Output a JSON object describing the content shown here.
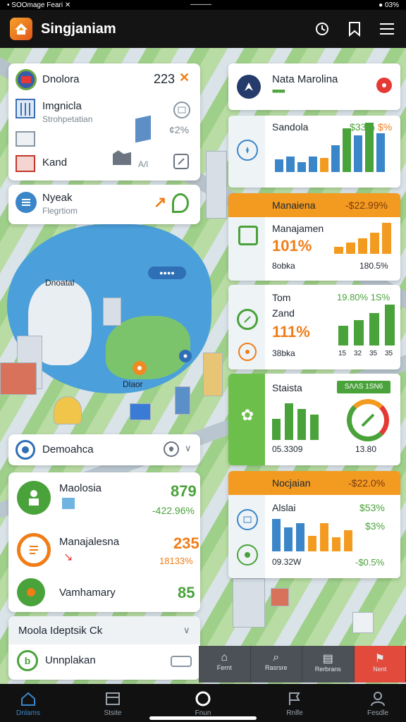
{
  "status": {
    "left": "• SOOmage Feari ✕",
    "mid": "―――",
    "right": "● 03%"
  },
  "header": {
    "title": "Singjaniam"
  },
  "left_panels": {
    "top": {
      "row1": {
        "label": "Dnolora",
        "value": "223",
        "close": "✕"
      },
      "row2": {
        "label": "Imgnicla",
        "sub": "Strohpetatian",
        "value": "¢2%"
      },
      "row3": {
        "label": "Kand",
        "tag": "A/l"
      }
    },
    "second": {
      "label": "Nyeak",
      "sub": "Flegrtiom"
    },
    "map_labels": {
      "island": "Dnoatal",
      "pill": "●●●●",
      "city": "Dlaor"
    },
    "demo": {
      "label": "Demoahca"
    },
    "stats": {
      "r1": {
        "label": "Maolosia",
        "value": "879",
        "sub": "-422.96%"
      },
      "r2": {
        "label": "Manajalesna",
        "value": "235",
        "sub": "18133%"
      },
      "r3": {
        "label": "Vamhamary",
        "value": "85"
      }
    },
    "dropdown": {
      "label": "Moola Ideptsik Ck"
    },
    "last": {
      "label": "Unnplakan"
    }
  },
  "right_panels": {
    "c1": {
      "label": "Nata Marolina",
      "tag": "■■■■"
    },
    "c2": {
      "label": "Sandola",
      "value1": "$33%",
      "value2": "$%",
      "bars": [
        18,
        22,
        14,
        22,
        20,
        38,
        62,
        52,
        70,
        55
      ]
    },
    "c3": {
      "header": "Manaiena",
      "header_value": "-$22.99%",
      "label": "Manajamen",
      "value": "101%",
      "sub": "8obka",
      "pct": "180.5%",
      "bars": [
        10,
        16,
        22,
        30,
        44
      ]
    },
    "c4": {
      "label": "Tom",
      "label2": "Zand",
      "value": "111%",
      "sub": "38bka",
      "pct": "19.80% 1S%",
      "ticks": [
        "15",
        "32",
        "35",
        "35"
      ],
      "bars": [
        28,
        36,
        46,
        58
      ]
    },
    "c5": {
      "label": "Staista",
      "badge": "SΛΛS 1SΝ6",
      "value": "05.3309",
      "gauge": "13.80",
      "bars": [
        30,
        52,
        44,
        36
      ]
    },
    "c6": {
      "header": "Nocjaian",
      "header_value": "-$22.0%",
      "label": "Alslai",
      "value": "$53%",
      "value2": "$3%",
      "sub": "09.32W",
      "pct": "-$0.5%",
      "bars": [
        46,
        34,
        40,
        22,
        40,
        20,
        30
      ]
    }
  },
  "bottom_tools": [
    "Fernt",
    "Rasrsre",
    "Rerbrans",
    "Nent"
  ],
  "tabs": [
    "Dnlams",
    "Stsite",
    "Fnun",
    "Rnlfe",
    "Fesdle"
  ],
  "colors": {
    "green": "#4aa23a",
    "orange": "#f39b21",
    "blue": "#3b86c9"
  }
}
